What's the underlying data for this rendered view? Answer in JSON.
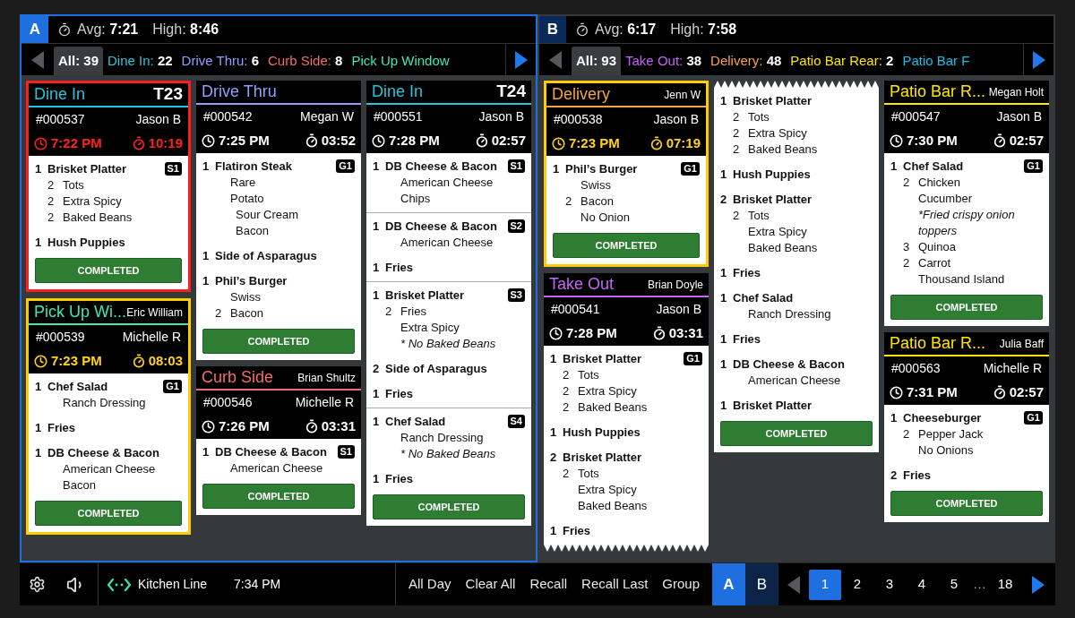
{
  "panels": [
    {
      "letter": "A",
      "selected": true,
      "stats": {
        "avg_label": "Avg:",
        "avg": "7:21",
        "high_label": "High:",
        "high": "8:46"
      },
      "filter": {
        "prev_disabled": true,
        "next_disabled": false,
        "tabs": [
          {
            "label": "All:",
            "count": "39",
            "selected": true
          },
          {
            "label": "Dine In:",
            "count": "22",
            "color": "#26c6da",
            "selected": false
          },
          {
            "label": "Drive Thru:",
            "count": "6",
            "color": "#8fa0ff",
            "selected": false
          },
          {
            "label": "Curb Side:",
            "count": "8",
            "color": "#f26b6b",
            "selected": false
          },
          {
            "label": "Pick Up Window",
            "color": "#3de8b8",
            "selected": false
          }
        ]
      },
      "columns": [
        [
          {
            "title": "Dine In",
            "color": "#26c6da",
            "corner": {
              "kind": "table",
              "text": "T23"
            },
            "order": "#000537",
            "server": "Jason B",
            "time": "7:22 PM",
            "elapsed": "10:19",
            "kind": "late",
            "torn_top": false,
            "torn_bottom": false,
            "button": "COMPLETED",
            "sections": [
              {
                "seat": "S1",
                "items": [
                  {
                    "qty": "1",
                    "name": "Brisket Platter",
                    "mods": [
                      {
                        "qty": "2",
                        "text": "Tots",
                        "kind": "mod"
                      },
                      {
                        "qty": "2",
                        "text": "Extra Spicy",
                        "kind": "mod"
                      },
                      {
                        "qty": "2",
                        "text": "Baked Beans",
                        "kind": "mod"
                      }
                    ]
                  },
                  {
                    "qty": "1",
                    "name": "Hush Puppies"
                  }
                ]
              }
            ]
          },
          {
            "title": "Pick Up Wi...",
            "color": "#3de8b8",
            "corner": {
              "kind": "server",
              "text": "Eric William"
            },
            "order": "#000539",
            "server": "Michelle R",
            "time": "7:23 PM",
            "elapsed": "08:03",
            "kind": "warning",
            "torn_top": false,
            "torn_bottom": false,
            "button": "COMPLETED",
            "sections": [
              {
                "seat": "G1",
                "items": [
                  {
                    "qty": "1",
                    "name": "Chef Salad",
                    "mods": [
                      {
                        "text": "Ranch Dressing",
                        "kind": "mod"
                      }
                    ]
                  },
                  {
                    "qty": "1",
                    "name": "Fries"
                  },
                  {
                    "qty": "1",
                    "name": "DB Cheese & Bacon",
                    "mods": [
                      {
                        "text": "American Cheese",
                        "kind": "mod"
                      },
                      {
                        "text": "Bacon",
                        "kind": "mod"
                      }
                    ]
                  }
                ]
              }
            ]
          }
        ],
        [
          {
            "title": "Drive Thru",
            "color": "#8fa0ff",
            "order": "#000542",
            "server": "Megan W",
            "time": "7:25 PM",
            "elapsed": "03:52",
            "kind": "normal",
            "torn_top": false,
            "torn_bottom": false,
            "button": "COMPLETED",
            "sections": [
              {
                "seat": "G1",
                "items": [
                  {
                    "qty": "1",
                    "name": "Flatiron Steak",
                    "mods": [
                      {
                        "text": "Rare",
                        "kind": "mod"
                      },
                      {
                        "text": "Potato",
                        "kind": "mod",
                        "children": [
                          {
                            "text": "Sour Cream",
                            "kind": "mod"
                          },
                          {
                            "text": "Bacon",
                            "kind": "mod"
                          }
                        ]
                      }
                    ]
                  },
                  {
                    "qty": "1",
                    "name": "Side of Asparagus"
                  },
                  {
                    "qty": "1",
                    "name": "Phil’s Burger",
                    "mods": [
                      {
                        "text": "Swiss",
                        "kind": "mod"
                      },
                      {
                        "qty": "2",
                        "text": "Bacon",
                        "kind": "mod"
                      }
                    ]
                  }
                ]
              }
            ]
          },
          {
            "title": "Curb Side",
            "color": "#f26b6b",
            "corner": {
              "kind": "server",
              "text": "Brian Shultz"
            },
            "order": "#000546",
            "server": "Michelle R",
            "time": "7:26 PM",
            "elapsed": "03:31",
            "kind": "normal",
            "torn_top": false,
            "torn_bottom": false,
            "button": "COMPLETED",
            "sections": [
              {
                "seat": "S1",
                "items": [
                  {
                    "qty": "1",
                    "name": "DB Cheese & Bacon",
                    "mods": [
                      {
                        "text": "American Cheese",
                        "kind": "mod"
                      }
                    ]
                  }
                ]
              }
            ]
          }
        ],
        [
          {
            "title": "Dine In",
            "color": "#26c6da",
            "corner": {
              "kind": "table",
              "text": "T24"
            },
            "order": "#000551",
            "server": "Jason B",
            "time": "7:28 PM",
            "elapsed": "02:57",
            "kind": "normal",
            "torn_top": false,
            "torn_bottom": false,
            "button": "COMPLETED",
            "sections": [
              {
                "seat": "S1",
                "items": [
                  {
                    "qty": "1",
                    "name": "DB Cheese & Bacon",
                    "mods": [
                      {
                        "text": "American Cheese",
                        "kind": "mod"
                      },
                      {
                        "text": "Chips",
                        "kind": "mod"
                      }
                    ]
                  }
                ]
              },
              {
                "seat": "S2",
                "items": [
                  {
                    "qty": "1",
                    "name": "DB Cheese & Bacon",
                    "mods": [
                      {
                        "text": "American Cheese",
                        "kind": "mod"
                      }
                    ]
                  },
                  {
                    "qty": "1",
                    "name": "Fries"
                  }
                ]
              },
              {
                "seat": "S3",
                "items": [
                  {
                    "qty": "1",
                    "name": "Brisket Platter",
                    "mods": [
                      {
                        "qty": "2",
                        "text": "Fries",
                        "kind": "mod"
                      },
                      {
                        "text": "Extra Spicy",
                        "kind": "mod"
                      },
                      {
                        "text": "* No Baked Beans",
                        "kind": "note"
                      }
                    ]
                  },
                  {
                    "qty": "2",
                    "name": "Side of Asparagus"
                  },
                  {
                    "qty": "1",
                    "name": "Fries"
                  }
                ]
              },
              {
                "seat": "S4",
                "items": [
                  {
                    "qty": "1",
                    "name": "Chef Salad",
                    "mods": [
                      {
                        "text": "Ranch Dressing",
                        "kind": "mod"
                      },
                      {
                        "text": "* No Baked Beans",
                        "kind": "note"
                      }
                    ]
                  },
                  {
                    "qty": "1",
                    "name": "Fries"
                  }
                ]
              }
            ]
          }
        ]
      ]
    },
    {
      "letter": "B",
      "selected": false,
      "stats": {
        "avg_label": "Avg:",
        "avg": "6:17",
        "high_label": "High:",
        "high": "7:58"
      },
      "filter": {
        "prev_disabled": true,
        "next_disabled": false,
        "tabs": [
          {
            "label": "All:",
            "count": "93",
            "selected": true
          },
          {
            "label": "Take Out:",
            "count": "38",
            "color": "#c465f5",
            "selected": false
          },
          {
            "label": "Delivery:",
            "count": "48",
            "color": "#f5a442",
            "selected": false
          },
          {
            "label": "Patio Bar Rear:",
            "count": "2",
            "color": "#ffe600",
            "selected": false
          },
          {
            "label": "Patio Bar F",
            "color": "#17c0e8",
            "selected": false
          }
        ]
      },
      "columns": [
        [
          {
            "title": "Delivery",
            "color": "#f5a442",
            "corner": {
              "kind": "server",
              "text": "Jenn W"
            },
            "order": "#000538",
            "server": "Jason B",
            "time": "7:23 PM",
            "elapsed": "07:19",
            "kind": "warning",
            "torn_top": false,
            "torn_bottom": false,
            "button": "COMPLETED",
            "sections": [
              {
                "seat": "G1",
                "items": [
                  {
                    "qty": "1",
                    "name": "Phil’s Burger",
                    "mods": [
                      {
                        "text": "Swiss",
                        "kind": "mod"
                      },
                      {
                        "qty": "2",
                        "text": "Bacon",
                        "kind": "mod"
                      },
                      {
                        "text": "No Onion",
                        "kind": "mod"
                      }
                    ]
                  }
                ]
              }
            ]
          },
          {
            "title": "Take Out",
            "color": "#c465f5",
            "corner": {
              "kind": "server",
              "text": "Brian Doyle"
            },
            "order": "#000541",
            "server": "Jason B",
            "time": "7:28 PM",
            "elapsed": "03:31",
            "kind": "normal",
            "torn_top": false,
            "torn_bottom": true,
            "sections": [
              {
                "seat": "G1",
                "items": [
                  {
                    "qty": "1",
                    "name": "Brisket Platter",
                    "mods": [
                      {
                        "qty": "2",
                        "text": "Tots",
                        "kind": "mod"
                      },
                      {
                        "qty": "2",
                        "text": "Extra Spicy",
                        "kind": "mod"
                      },
                      {
                        "qty": "2",
                        "text": "Baked Beans",
                        "kind": "mod"
                      }
                    ]
                  },
                  {
                    "qty": "1",
                    "name": "Hush Puppies"
                  },
                  {
                    "qty": "2",
                    "name": "Brisket Platter",
                    "mods": [
                      {
                        "qty": "2",
                        "text": "Tots",
                        "kind": "mod"
                      },
                      {
                        "text": "Extra Spicy",
                        "kind": "mod"
                      },
                      {
                        "text": "Baked Beans",
                        "kind": "mod"
                      }
                    ]
                  },
                  {
                    "qty": "1",
                    "name": "Fries"
                  }
                ]
              }
            ]
          }
        ],
        [
          {
            "kind": "normal",
            "torn_top": true,
            "torn_bottom": false,
            "button": "COMPLETED",
            "sections": [
              {
                "items": [
                  {
                    "qty": "1",
                    "name": "Brisket Platter",
                    "mods": [
                      {
                        "qty": "2",
                        "text": "Tots",
                        "kind": "mod"
                      },
                      {
                        "qty": "2",
                        "text": "Extra Spicy",
                        "kind": "mod"
                      },
                      {
                        "qty": "2",
                        "text": "Baked Beans",
                        "kind": "mod"
                      }
                    ]
                  },
                  {
                    "qty": "1",
                    "name": "Hush Puppies"
                  },
                  {
                    "qty": "2",
                    "name": "Brisket Platter",
                    "mods": [
                      {
                        "qty": "2",
                        "text": "Tots",
                        "kind": "mod"
                      },
                      {
                        "text": "Extra Spicy",
                        "kind": "mod"
                      },
                      {
                        "text": "Baked Beans",
                        "kind": "mod"
                      }
                    ]
                  },
                  {
                    "qty": "1",
                    "name": "Fries"
                  },
                  {
                    "qty": "1",
                    "name": "Chef Salad",
                    "mods": [
                      {
                        "text": "Ranch Dressing",
                        "kind": "mod"
                      }
                    ]
                  },
                  {
                    "qty": "1",
                    "name": "Fries"
                  },
                  {
                    "qty": "1",
                    "name": "DB Cheese & Bacon",
                    "mods": [
                      {
                        "text": "American Cheese",
                        "kind": "mod"
                      }
                    ]
                  },
                  {
                    "qty": "1",
                    "name": "Brisket Platter"
                  }
                ]
              }
            ]
          }
        ],
        [
          {
            "title": "Patio Bar R...",
            "color": "#ffe600",
            "corner": {
              "kind": "server",
              "text": "Megan Holt"
            },
            "order": "#000547",
            "server": "Jason B",
            "time": "7:30 PM",
            "elapsed": "02:57",
            "kind": "normal",
            "torn_top": false,
            "torn_bottom": false,
            "button": "COMPLETED",
            "sections": [
              {
                "seat": "G1",
                "items": [
                  {
                    "qty": "1",
                    "name": "Chef Salad",
                    "mods": [
                      {
                        "qty": "2",
                        "text": "Chicken",
                        "kind": "mod"
                      },
                      {
                        "text": "Cucumber",
                        "kind": "mod"
                      },
                      {
                        "text": "*Fried crispy onion toppers",
                        "kind": "note"
                      },
                      {
                        "qty": "3",
                        "text": "Quinoa",
                        "kind": "mod"
                      },
                      {
                        "qty": "2",
                        "text": "Carrot",
                        "kind": "mod"
                      },
                      {
                        "text": "Thousand Island",
                        "kind": "mod"
                      }
                    ]
                  }
                ]
              }
            ]
          },
          {
            "title": "Patio Bar R...",
            "color": "#ffe600",
            "corner": {
              "kind": "server",
              "text": "Julia Baff"
            },
            "order": "#000563",
            "server": "Michelle R",
            "time": "7:31 PM",
            "elapsed": "02:57",
            "kind": "normal",
            "torn_top": false,
            "torn_bottom": false,
            "button": "COMPLETED",
            "sections": [
              {
                "seat": "G1",
                "items": [
                  {
                    "qty": "1",
                    "name": "Cheeseburger",
                    "mods": [
                      {
                        "qty": "2",
                        "text": "Pepper Jack",
                        "kind": "mod"
                      },
                      {
                        "text": "No Onions",
                        "kind": "mod"
                      }
                    ]
                  },
                  {
                    "qty": "2",
                    "name": "Fries"
                  }
                ]
              }
            ]
          }
        ]
      ]
    }
  ],
  "footer": {
    "station": "Kitchen Line",
    "clock": "7:34 PM",
    "actions": [
      "All Day",
      "Clear All",
      "Recall",
      "Recall Last",
      "Group"
    ],
    "screens": [
      {
        "label": "A",
        "selected": true
      },
      {
        "label": "B",
        "selected": false
      }
    ],
    "pager": {
      "prev_disabled": true,
      "next_disabled": false,
      "pages": [
        {
          "label": "1",
          "selected": true
        },
        {
          "label": "2",
          "selected": false
        },
        {
          "label": "3",
          "selected": false
        },
        {
          "label": "4",
          "selected": false
        },
        {
          "label": "5",
          "selected": false
        }
      ],
      "ellipsis": "…",
      "last": {
        "label": "18",
        "selected": false
      }
    }
  }
}
